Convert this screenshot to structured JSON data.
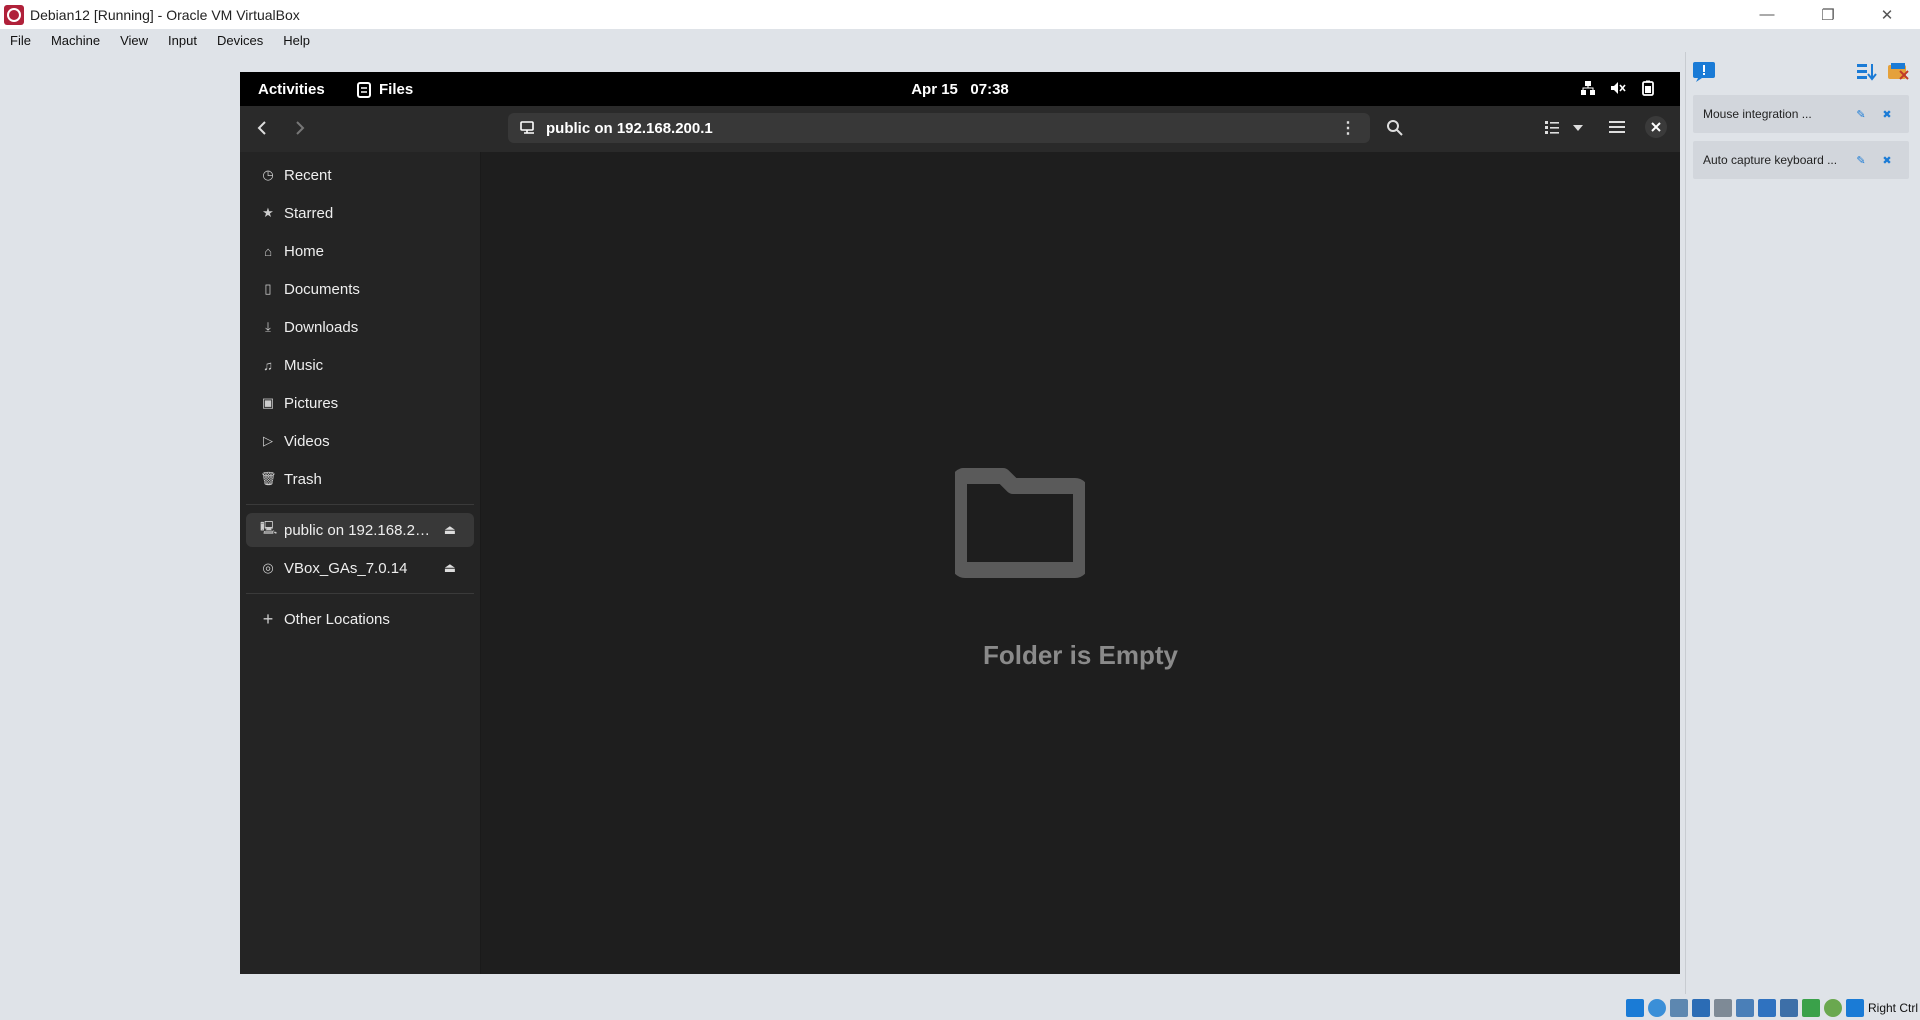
{
  "window": {
    "title": "Debian12 [Running] - Oracle VM VirtualBox"
  },
  "menu": [
    "File",
    "Machine",
    "View",
    "Input",
    "Devices",
    "Help"
  ],
  "gnome_top": {
    "activities": "Activities",
    "app": "Files",
    "date": "Apr 15",
    "time": "07:38"
  },
  "header": {
    "path": "public on 192.168.200.1"
  },
  "sidebar": {
    "places": [
      {
        "label": "Recent",
        "icon": "clock-icon"
      },
      {
        "label": "Starred",
        "icon": "star-icon"
      },
      {
        "label": "Home",
        "icon": "home-icon"
      },
      {
        "label": "Documents",
        "icon": "document-icon"
      },
      {
        "label": "Downloads",
        "icon": "download-icon"
      },
      {
        "label": "Music",
        "icon": "music-icon"
      },
      {
        "label": "Pictures",
        "icon": "picture-icon"
      },
      {
        "label": "Videos",
        "icon": "video-icon"
      },
      {
        "label": "Trash",
        "icon": "trash-icon"
      }
    ],
    "mounts": [
      {
        "label": "public on 192.168.2…",
        "icon": "network-drive-icon"
      },
      {
        "label": "VBox_GAs_7.0.14",
        "icon": "disc-icon"
      }
    ],
    "other": "Other Locations"
  },
  "main": {
    "empty_text": "Folder is Empty"
  },
  "notifications": [
    {
      "text": "Mouse integration ..."
    },
    {
      "text": "Auto capture keyboard ..."
    }
  ],
  "status": {
    "host_key": "Right Ctrl"
  }
}
